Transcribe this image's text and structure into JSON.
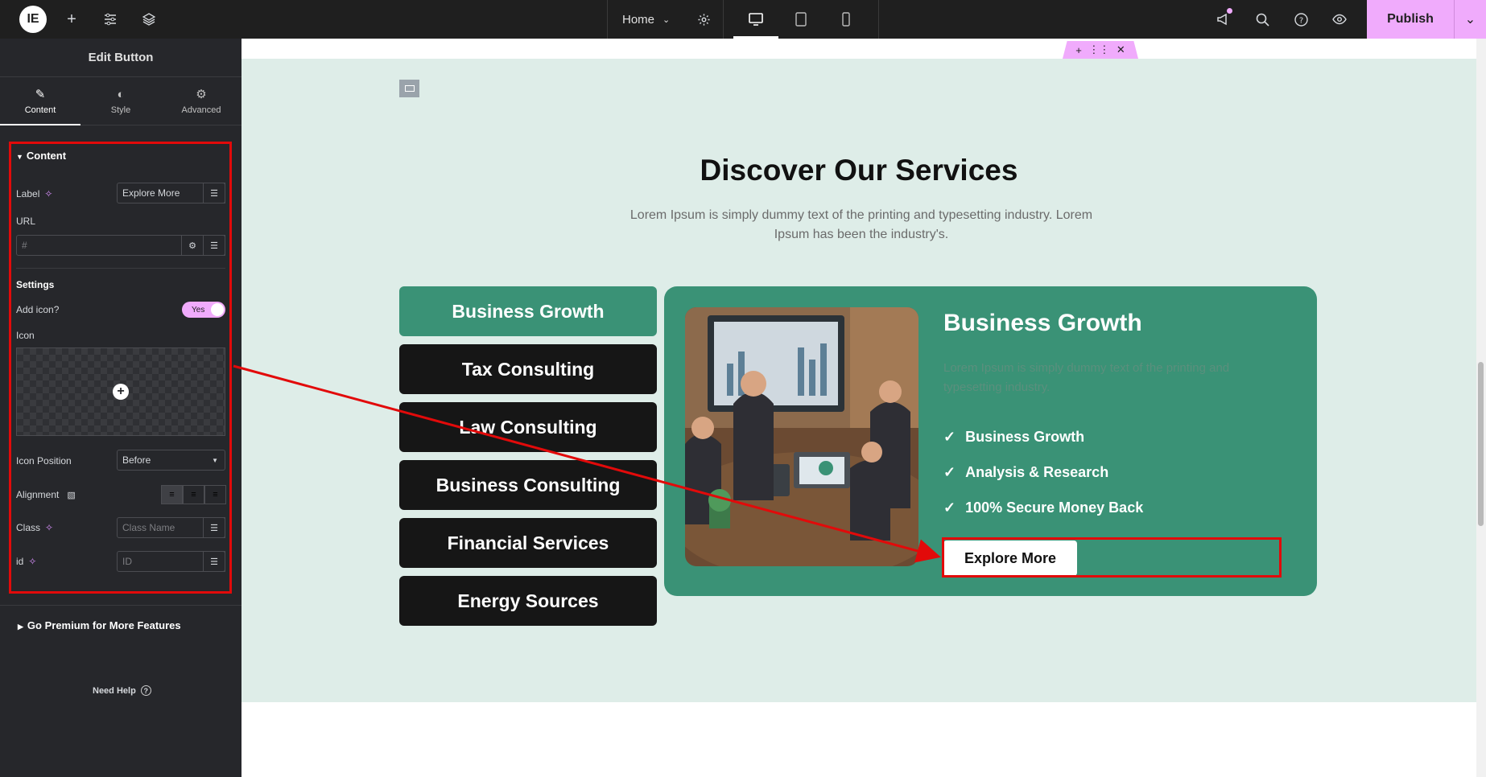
{
  "topbar": {
    "logo": "IE",
    "page_name": "Home",
    "publish": "Publish"
  },
  "panel": {
    "title": "Edit Button",
    "tabs": [
      {
        "label": "Content",
        "icon": "pencil-icon"
      },
      {
        "label": "Style",
        "icon": "contrast-icon"
      },
      {
        "label": "Advanced",
        "icon": "gear-icon"
      }
    ],
    "section_title": "Content",
    "label_title": "Label",
    "label_value": "Explore More",
    "url_title": "URL",
    "url_placeholder": "#",
    "settings_title": "Settings",
    "add_icon_title": "Add icon?",
    "add_icon_toggle": "Yes",
    "icon_title": "Icon",
    "icon_position_title": "Icon Position",
    "icon_position_value": "Before",
    "alignment_title": "Alignment",
    "class_title": "Class",
    "class_placeholder": "Class Name",
    "id_title": "id",
    "id_placeholder": "ID",
    "premium_title": "Go Premium for More Features",
    "help": "Need Help"
  },
  "page": {
    "heading": "Discover Our Services",
    "subtext": "Lorem Ipsum is simply dummy text of the printing and typesetting industry. Lorem Ipsum has been the industry's.",
    "tabs": [
      "Business Growth",
      "Tax Consulting",
      "Law Consulting",
      "Business Consulting",
      "Financial Services",
      "Energy Sources"
    ],
    "active_tab": 0,
    "card": {
      "title": "Business Growth",
      "text": "Lorem Ipsum is simply dummy text of the printing and typesetting industry.",
      "checks": [
        "Business Growth",
        "Analysis & Research",
        "100% Secure Money Back"
      ],
      "button": "Explore More"
    }
  },
  "colors": {
    "accent": "#3a9276",
    "publish": "#f0abfc",
    "annotation": "#e20a0a"
  }
}
